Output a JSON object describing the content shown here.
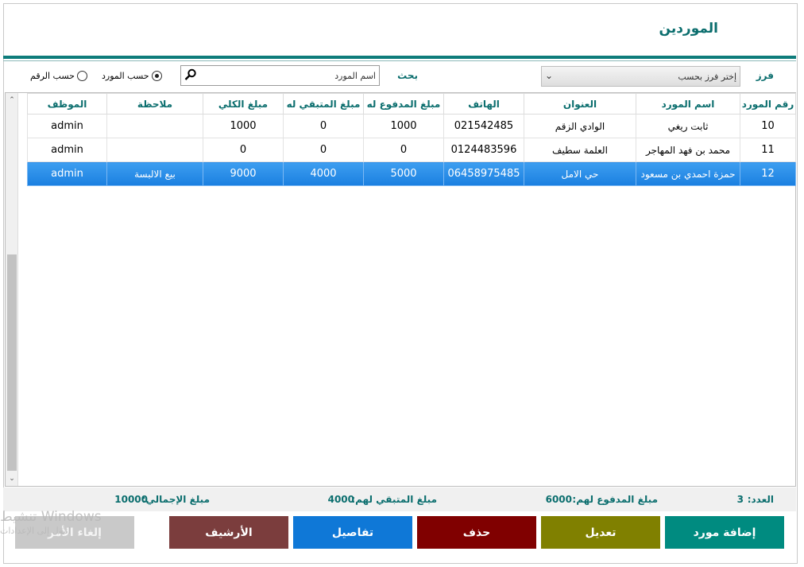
{
  "window": {
    "title": "الموردين"
  },
  "filter": {
    "sort_label": "فرز",
    "sort_value": "إختر فرز بحسب",
    "search_label": "بحث",
    "search_placeholder": "اسم المورد"
  },
  "radios": [
    {
      "label": "حسب المورد",
      "checked": true
    },
    {
      "label": "حسب الرقم",
      "checked": false
    }
  ],
  "table": {
    "columns": [
      "رقم المورد",
      "اسم المورد",
      "العنوان",
      "الهاتف",
      "مبلغ المدفوع له",
      "مبلغ المتبقي له",
      "مبلغ الكلي",
      "ملاحظة",
      "الموظف"
    ],
    "rows": [
      [
        "10",
        "ثابت ريغي",
        "الوادي الزقم",
        "021542485",
        "1000",
        "0",
        "1000",
        "",
        "admin"
      ],
      [
        "11",
        "محمد بن فهد المهاجر",
        "العلمة سطيف",
        "0124483596",
        "0",
        "0",
        "0",
        "",
        "admin"
      ],
      [
        "12",
        "حمزة احمدي بن مسعود",
        "حي الامل",
        "06458975485",
        "5000",
        "4000",
        "9000",
        "بيع الالبسة",
        "admin"
      ]
    ],
    "selected_row": 2
  },
  "footer": {
    "count_label": "العدد:",
    "count_value": "3",
    "paid_label": "مبلغ المدفوع لهم:",
    "paid_value": "6000",
    "remaining_label": "مبلغ المتبقي لهم:",
    "remaining_value": "4000",
    "total_label": "مبلغ الإجمالي:",
    "total_value": "10000"
  },
  "buttons": {
    "add": "إضافة مورد",
    "edit": "تعديل",
    "delete": "حذف",
    "details": "تفاصيل",
    "archive": "الأرشيف",
    "cancel": "إلغاء الأمر"
  },
  "watermark": {
    "line1": "تنشيط Windows",
    "line2": "انتقل إلى الإعدادات"
  }
}
